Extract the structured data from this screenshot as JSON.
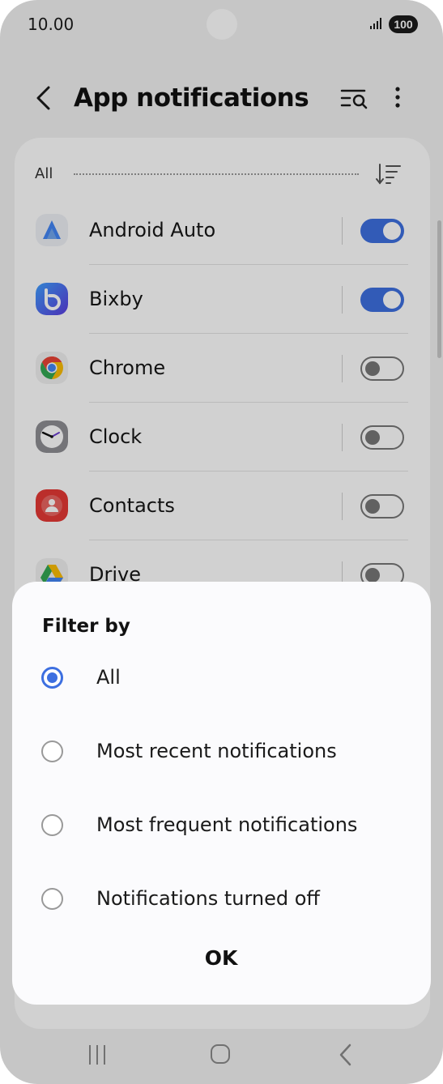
{
  "status_bar": {
    "time": "10.00",
    "battery": "100"
  },
  "header": {
    "title": "App notifications"
  },
  "list": {
    "filter_label": "All",
    "apps": [
      {
        "name": "Android Auto",
        "enabled": true,
        "icon": "android-auto-icon"
      },
      {
        "name": "Bixby",
        "enabled": true,
        "icon": "bixby-icon"
      },
      {
        "name": "Chrome",
        "enabled": false,
        "icon": "chrome-icon"
      },
      {
        "name": "Clock",
        "enabled": false,
        "icon": "clock-icon"
      },
      {
        "name": "Contacts",
        "enabled": false,
        "icon": "contacts-icon"
      },
      {
        "name": "Drive",
        "enabled": false,
        "icon": "drive-icon"
      }
    ]
  },
  "dialog": {
    "title": "Filter by",
    "options": [
      {
        "label": "All",
        "selected": true
      },
      {
        "label": "Most recent notifications",
        "selected": false
      },
      {
        "label": "Most frequent notifications",
        "selected": false
      },
      {
        "label": "Notifications turned off",
        "selected": false
      }
    ],
    "ok_label": "OK"
  },
  "colors": {
    "accent": "#3d6fe0",
    "toggle_off": "#777777",
    "dialog_bg": "#fbfbfd"
  }
}
